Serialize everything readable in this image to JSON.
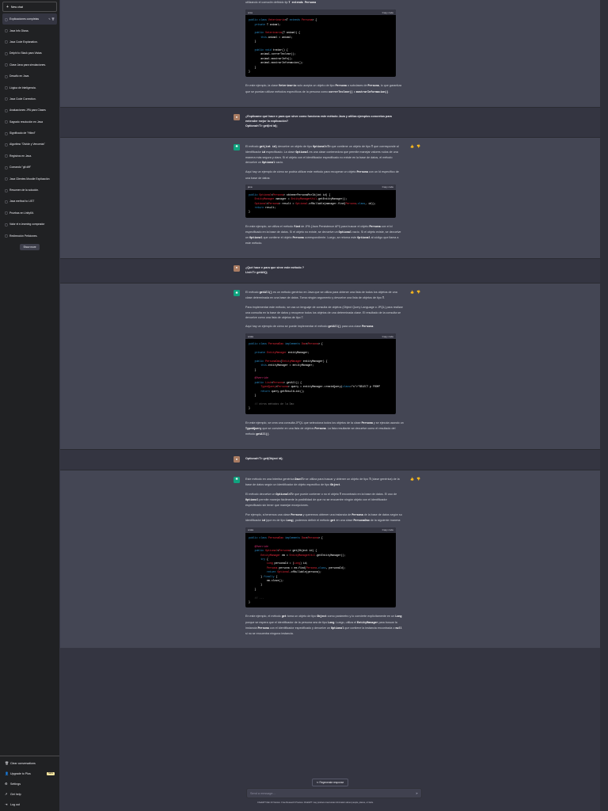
{
  "sidebar": {
    "new_chat": "New chat",
    "conversations": [
      {
        "label": "Explicaciones completas",
        "active": true
      },
      {
        "label": "Java Info Diana."
      },
      {
        "label": "Java Code Explanation."
      },
      {
        "label": "Delphi to Stack para Vistas"
      },
      {
        "label": "Clase Java para simulaciones."
      },
      {
        "label": "Desafio en Java."
      },
      {
        "label": "Lógica de Inteligencia."
      },
      {
        "label": "Java Code Correction."
      },
      {
        "label": "Avaluaciones JPA para Clases"
      },
      {
        "label": "Sagrado resolución en Java"
      },
      {
        "label": "Significado de \"Hibrd\""
      },
      {
        "label": "Algoritmo \"Divide y Vencerás\""
      },
      {
        "label": "Registros en Java."
      },
      {
        "label": "Comando \"git diff\""
      },
      {
        "label": "Java Clientes Moodle Explicación"
      },
      {
        "label": "Resumen de la solución."
      },
      {
        "label": "Java method to LIST"
      },
      {
        "label": "Pruebas en UnityKit."
      },
      {
        "label": "Valor el e-learning comprador"
      },
      {
        "label": "Redirección Peticiones."
      }
    ],
    "show_more": "Show more",
    "bottom": {
      "clear": "Clear conversations",
      "upgrade": "Upgrade to Plus",
      "upgrade_badge": "NEW",
      "settings": "Settings",
      "help": "Get help",
      "logout": "Log out"
    }
  },
  "chat": {
    "frag_intro": "utilizando el comodín definido tip ",
    "frag_intro_code": "T extends Persona",
    "cb0": {
      "lang": "scss",
      "copy": "Copy code"
    },
    "frag_after": [
      "En este ejemplo, la clase ",
      "Veterinario",
      " solo acepta un objeto de tipo ",
      "Persona",
      " o subclases de ",
      "Persona",
      ", lo que garantiza que se puedan utilizar métodos específicos de la persona como ",
      "correrTeclear()",
      " o ",
      "mostrarInformacion()",
      "."
    ],
    "q1": "¿Explícame qué hace e para que sirve como funciona este método Java y utiliza ejemplos concretos para entender mejor la explicación?\nOptional<T> get(int id);",
    "a1_p1": [
      "El método ",
      "get(int id)",
      " devuelve un objeto de tipo ",
      "Optional<T>",
      " que contiene un objeto de tipo ",
      "T",
      " que corresponde al identificador ",
      "id",
      " especificado. La clase ",
      "Optional",
      " es una clase contenedora que permite manejar valores nulos de una manera más segura y clara. Si el objeto con el identificador especificado no existe en la base de datos, el método devuelve un ",
      "Optional",
      " vacío."
    ],
    "a1_p2": [
      "Aquí hay un ejemplo de cómo se podría utilizar este método para recuperar un objeto ",
      "Persona",
      " con un Id específico de una base de datos:"
    ],
    "cb1": {
      "lang": "java",
      "copy": "Copy code"
    },
    "a1_p3": [
      "En este ejemplo, se utiliza el método ",
      "find",
      " de JPA (Java Persistence API) para buscar el objeto ",
      "Persona",
      " con el id especificado en la base de datos. Si el objeto no existe, se devuelve un ",
      "Optional",
      " vacío. Si el objeto existe, se devuelve un ",
      "Optional",
      " que contiene el objeto ",
      "Persona",
      " correspondiente. Luego, se retorna este ",
      "Optional",
      " al código que llama a este método."
    ],
    "q2": "¿Qué hace e para que sirve este método ?\nList<T> getAll();",
    "a2_p1": [
      "El método ",
      "getAll()",
      " es un método genérico en Java que se utiliza para obtener una lista de todos los objetos de una clase determinada en una base de datos. Toma ningún argumento y devuelve una lista de objetos de tipo ",
      "T",
      "."
    ],
    "a2_p2": "Para implementar este método, se usa un lenguaje de consulta de objetos (Object Query Language o JPQL) para realizar una consulta en la base de datos y recuperar todos los objetos de una determinada clase. El resultado de la consulta se devuelve como una lista de objetos de tipo T.",
    "a2_p3": [
      "Aquí hay un ejemplo de cómo se puede implementar el método ",
      "getAll()",
      " para una clase ",
      "Persona",
      ":"
    ],
    "cb2": {
      "lang": "scala",
      "copy": "Copy code"
    },
    "a2_p4": [
      "En este ejemplo, se crea una consulta JPQL que selecciona todos los objetos de la clase ",
      "Persona",
      " y se ejecuta usando un ",
      "TypedQuery",
      " que se convierte en una lista de objetos ",
      "Persona",
      ". La lista resultante se devuelve como el resultado del método ",
      "getAll()",
      "."
    ],
    "q3": "Optional<T> get(Object id);",
    "a3_p1": [
      "Este método en una Interfaz genérica ",
      "Dao<T>",
      " se utiliza para buscar y obtener un objeto de tipo ",
      "T",
      " (clase genérica) de la base de datos según un identificador de objeto específico de tipo ",
      "Object",
      "."
    ],
    "a3_p2": [
      "El método devuelve un ",
      "Optional<T>",
      " que puede contener o no el objeto ",
      "T",
      " encontrado en la base de datos. El uso de ",
      "Optional",
      " permite manejar fácilmente la posibilidad de que no se encuentre ningún objeto con el identificador especificado sin tener que manejar excepciones."
    ],
    "a3_p3": [
      "Por ejemplo, si tenemos una clase ",
      "Persona",
      " y queremos obtener una instancia de ",
      "Persona",
      " de la base de datos según su identificador ",
      "id",
      " (que es de tipo ",
      "Long",
      "), podemos definir el método ",
      "get",
      " en una clase ",
      "PersonaDao",
      " de la siguiente manera:"
    ],
    "cb3": {
      "lang": "scala",
      "copy": "Copy code"
    },
    "a3_p4": [
      "En este ejemplo, el método ",
      "get",
      " toma un objeto de tipo ",
      "Object",
      " como parámetro y lo convierte explícitamente en un ",
      "Long",
      " porque se espera que el identificador de la persona sea de tipo ",
      "Long",
      ". Luego, utiliza el ",
      "EntityManager",
      " para buscar la instancia ",
      "Persona",
      " con el identificador especificado y devuelve un ",
      "Optional",
      " que contiene la instancia encontrada o ",
      "null",
      " si no se encuentra ninguna instancia."
    ]
  },
  "code": {
    "cb0": [
      "public class Veterinario<T extends Persona> {",
      "    private T animal;",
      "",
      "    public Veterinario(T animal) {",
      "        this.animal = animal;",
      "    }",
      "",
      "    public void tratar() {",
      "        animal.correrTeclear();",
      "        animal.mostrarInfo();",
      "        animal.mostrarInformacion();",
      "    }",
      "}"
    ],
    "cb1": [
      "public Optional<Persona> obtenerPersonaPorId(int id) {",
      "    EntityManager manager = EntityManagerUtil.getEntityManager();",
      "    Optional<Persona> result = Optional.ofNullable(manager.find(Persona.class, id));",
      "    return result;",
      "}"
    ],
    "cb2": [
      "public class PersonaDao implements Dao<Persona> {",
      "",
      "    private EntityManager entityManager;",
      "",
      "    public PersonaDao(EntityManager entityManager) {",
      "        this.entityManager = entityManager;",
      "    }",
      "",
      "    @Override",
      "    public List<Persona> getAll() {",
      "        TypedQuery<Persona> query = entityManager.createQuery(\"SELECT p FROM\"",
      "        return query.getResultList();",
      "    }",
      "",
      "    // otros métodos de la Dao",
      "}"
    ],
    "cb3": [
      "public class PersonaDao implements Dao<Persona> {",
      "",
      "    @Override",
      "    public Optional<Persona> get(Object id) {",
      "        EntityManager em = EntityManagerUtil.getEntityManager();",
      "        try {",
      "            Long personaId = (Long) id;",
      "            Persona persona = em.find(Persona.class, personaId);",
      "            return Optional.ofNullable(persona);",
      "        } finally {",
      "            em.close();",
      "        }",
      "    }",
      "",
      "    // ...",
      "}"
    ]
  },
  "composer": {
    "regenerate": "↻  Regenerate response",
    "placeholder": "Send a message...",
    "send_icon": "paper-plane-icon",
    "footer": "ChatGPT Mar 23 Version. Free Research Preview. ChatGPT may produce inaccurate information about people, places, or facts."
  },
  "colors": {
    "sidebar": "#202123",
    "user_row": "#343541",
    "assistant_row": "#444654",
    "accent": "#10a37f"
  }
}
